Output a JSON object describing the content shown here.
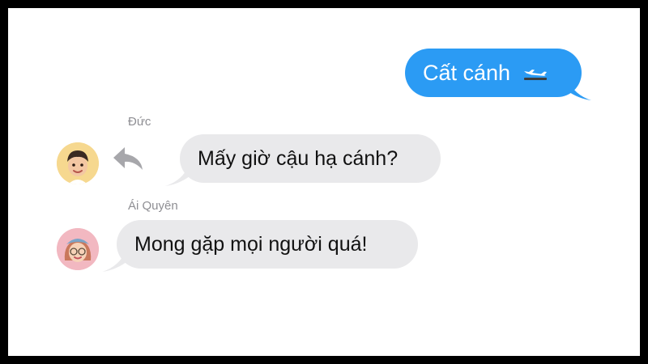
{
  "conversation": {
    "outgoing": [
      {
        "text": "Cất cánh",
        "icon": "airplane-departure-icon"
      }
    ],
    "incoming": [
      {
        "sender": "Đức",
        "text": "Mấy giờ cậu hạ cánh?",
        "avatar": "memoji-boy-avatar",
        "reply_icon": "reply-arrow-icon"
      },
      {
        "sender": "Ái Quyên",
        "text": "Mong gặp mọi người quá!",
        "avatar": "memoji-girl-avatar"
      }
    ]
  },
  "colors": {
    "outgoing_bubble": "#2b9bf4",
    "incoming_bubble": "#e9e9eb",
    "sender_name": "#8e8e93",
    "reply_icon": "#a7a7ab",
    "frame_border": "#000000"
  }
}
